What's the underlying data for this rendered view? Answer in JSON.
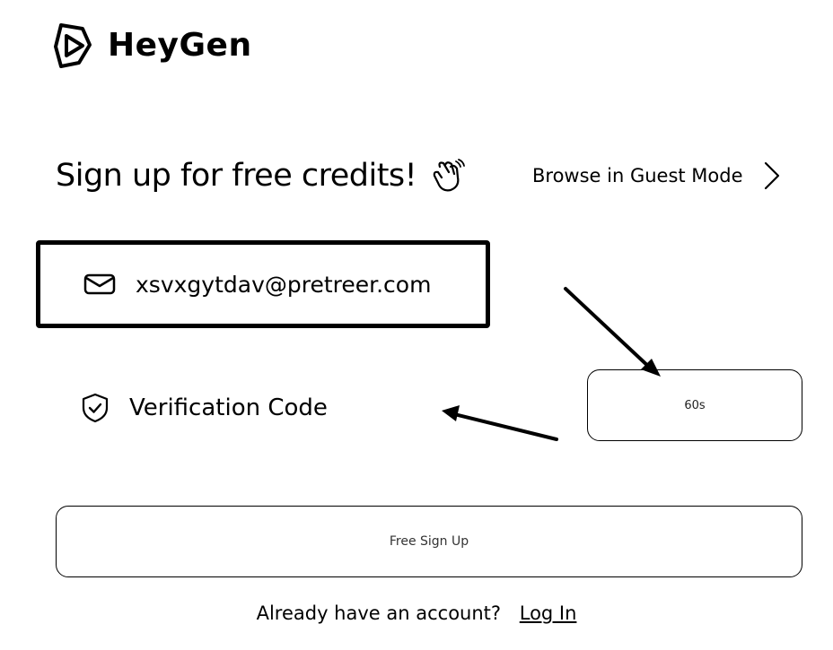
{
  "brand": {
    "name": "HeyGen",
    "logo_icon": "heygen-logo-icon"
  },
  "signup": {
    "heading": "Sign up for free credits!",
    "heading_icon": "waving-hand-icon",
    "guest_mode_label": "Browse in Guest Mode",
    "guest_mode_icon": "chevron-right-icon"
  },
  "email": {
    "icon": "mail-icon",
    "value": "xsvxgytdav@pretreer.com"
  },
  "verification": {
    "icon": "shield-check-icon",
    "placeholder": "Verification Code",
    "send_button_label": "60s"
  },
  "main_button": {
    "label": "Free Sign Up"
  },
  "footer": {
    "prompt": "Already have an account?",
    "login_label": "Log In"
  },
  "colors": {
    "text": "#000000",
    "background": "#ffffff",
    "border": "#000000"
  }
}
